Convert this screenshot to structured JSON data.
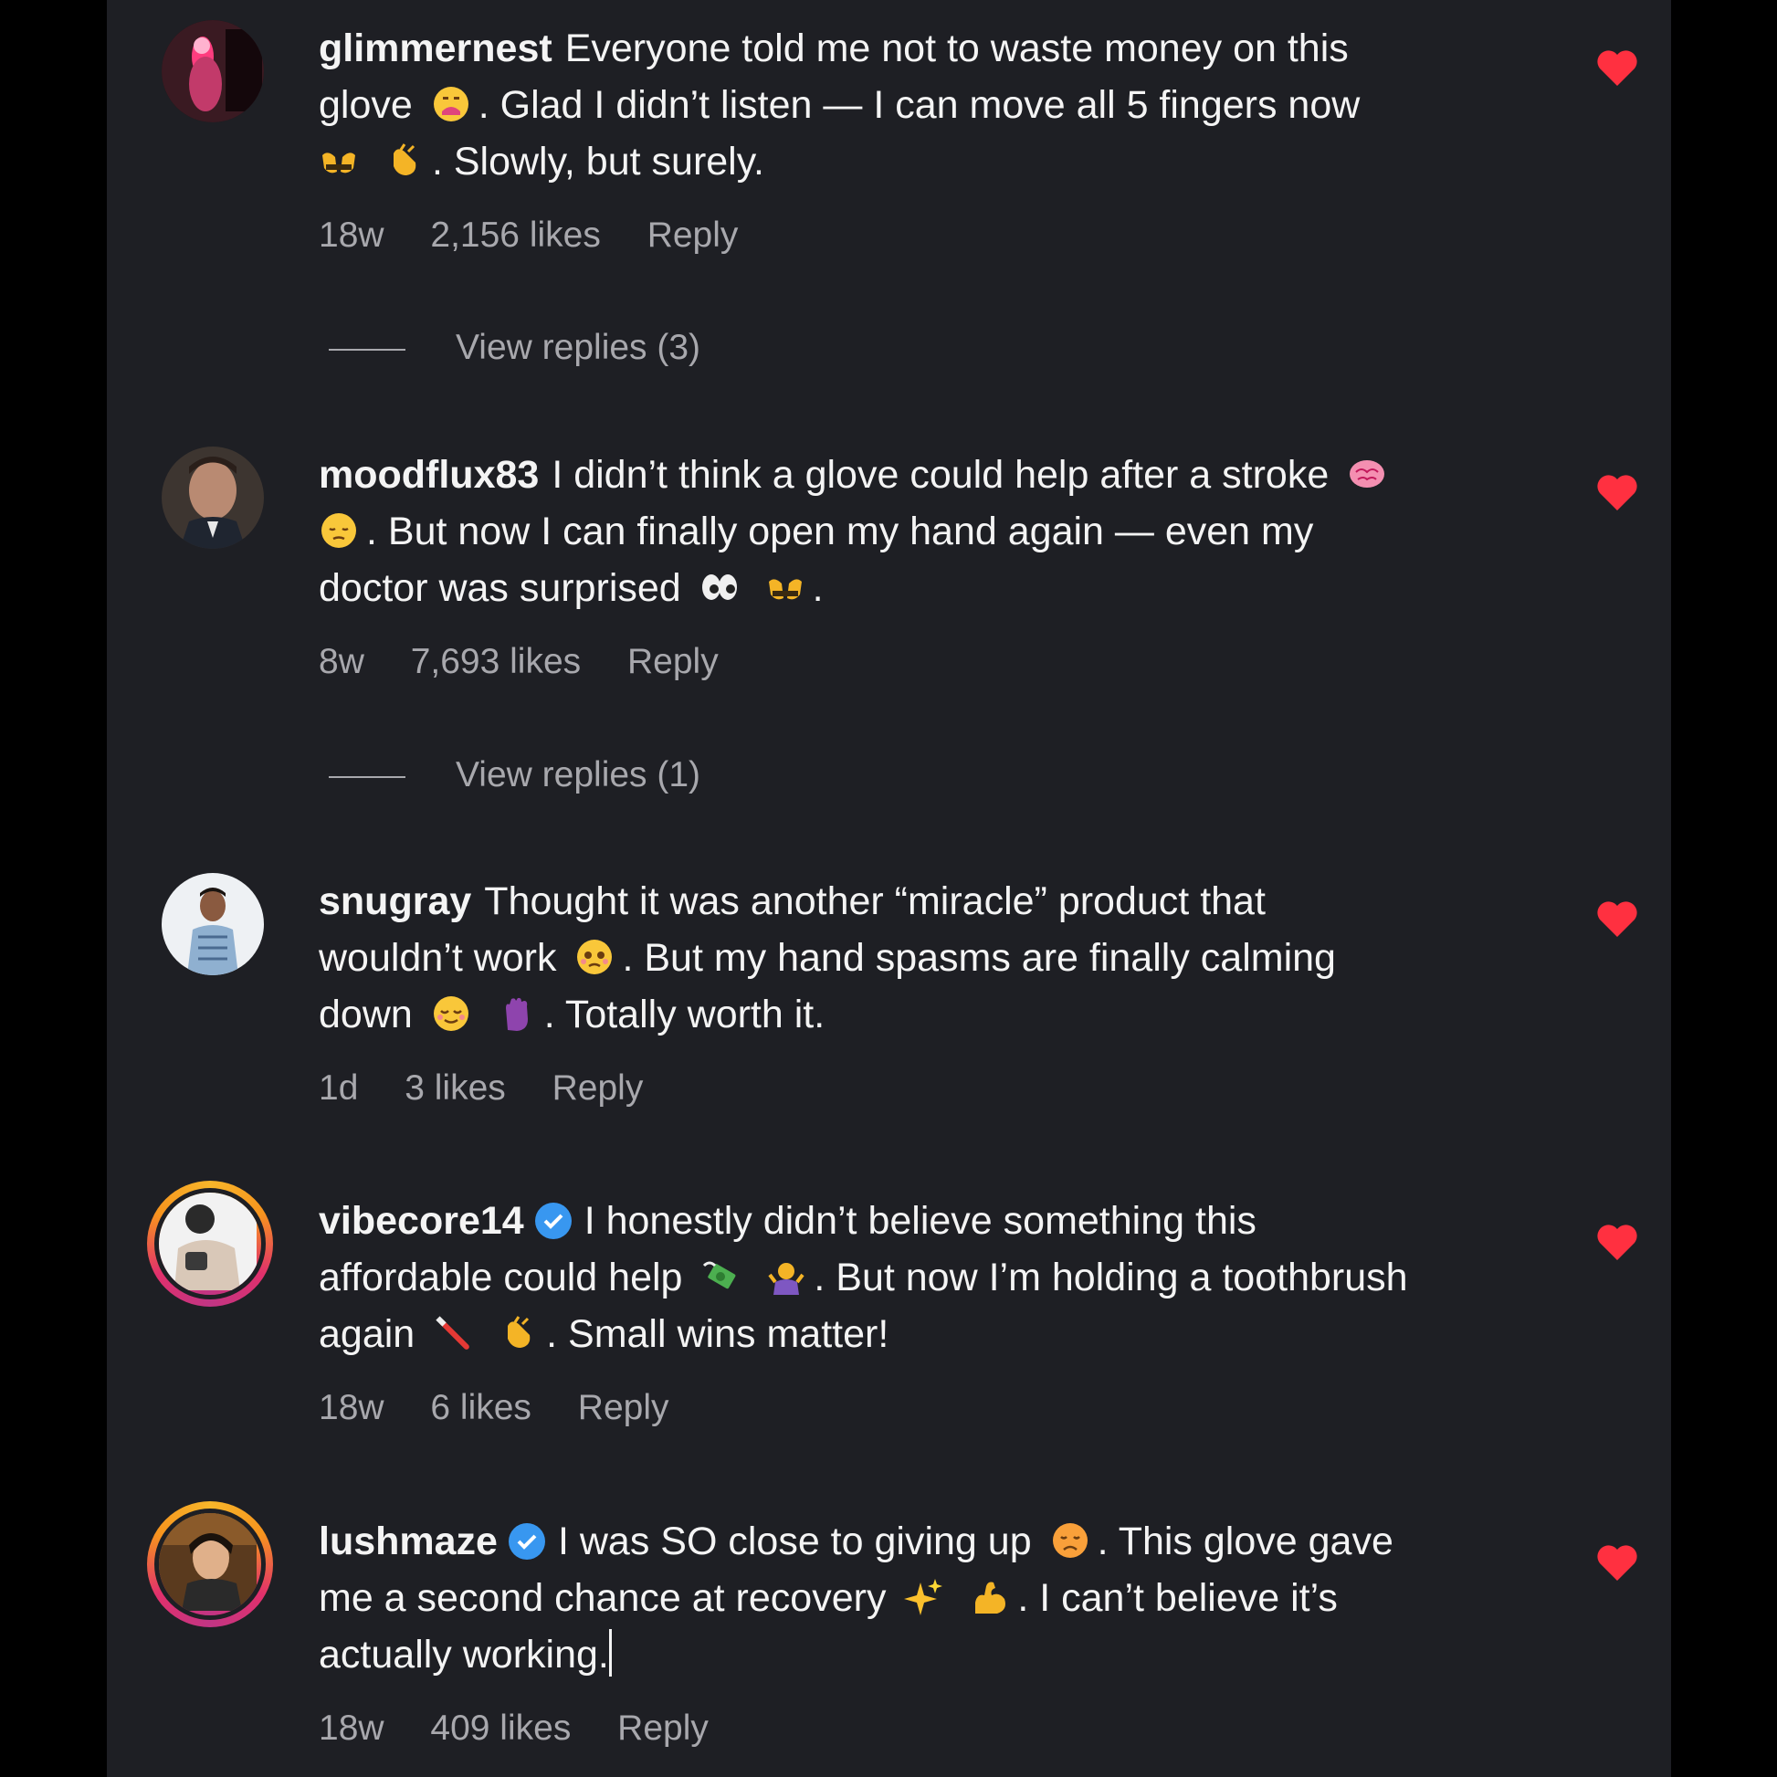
{
  "comments": [
    {
      "username": "glimmernest",
      "verified": false,
      "line1": "Everyone told me not to waste money on this",
      "line2a": "glove",
      "line2b": ". Glad I didn’t listen — I can move all 5 fingers now",
      "line3b": ". Slowly, but surely.",
      "age": "18w",
      "likes": "2,156 likes",
      "reply_label": "Reply",
      "view_replies": "View replies (3)",
      "liked": true
    },
    {
      "username": "moodflux83",
      "verified": false,
      "line1": "I didn’t think a glove could help after a stroke",
      "line2b": ". But now I can finally open my hand again — even my",
      "line3a": "doctor was surprised",
      "line3b": ".",
      "age": "8w",
      "likes": "7,693 likes",
      "reply_label": "Reply",
      "view_replies": "View replies (1)",
      "liked": true
    },
    {
      "username": "snugray",
      "verified": false,
      "line1": "Thought it was another “miracle” product that",
      "line2a": "wouldn’t work",
      "line2b": ". But my hand spasms are finally calming",
      "line3a": "down",
      "line3b": ". Totally worth it.",
      "age": "1d",
      "likes": "3 likes",
      "reply_label": "Reply",
      "liked": true
    },
    {
      "username": "vibecore14",
      "verified": true,
      "line1": "I honestly didn’t believe something this",
      "line2a": "affordable could help",
      "line2b": ". But now I’m holding a toothbrush",
      "line3a": "again",
      "line3b": ". Small wins matter!",
      "age": "18w",
      "likes": "6 likes",
      "reply_label": "Reply",
      "liked": true
    },
    {
      "username": "lushmaze",
      "verified": true,
      "line1a": "I was SO close to giving up",
      "line1b": ". This glove gave",
      "line2a": "me a second chance at recovery",
      "line2b": ". I can’t believe it’s",
      "line3a": "actually working.",
      "age": "18w",
      "likes": "409 likes",
      "reply_label": "Reply",
      "liked": true
    }
  ],
  "colors": {
    "panel_bg": "#1e1f24",
    "text": "#f4f4f4",
    "meta": "#a8a8ad",
    "heart": "#ff3040",
    "verified": "#3897f0"
  },
  "icons": {
    "heart": "heart-icon",
    "verified": "verified-badge-icon"
  }
}
